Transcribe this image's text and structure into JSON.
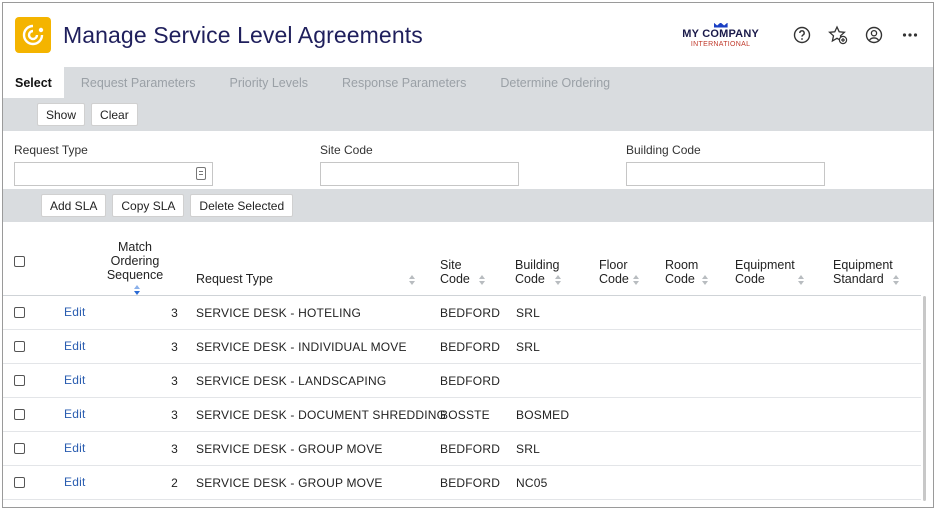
{
  "header": {
    "title": "Manage Service Level Agreements",
    "company_name": "MY COMPANY",
    "company_sub": "INTERNATIONAL"
  },
  "icons": [
    "app-logo-icon",
    "help-icon",
    "favorite-add-icon",
    "user-icon",
    "more-icon"
  ],
  "tabs": [
    {
      "label": "Select",
      "active": true
    },
    {
      "label": "Request Parameters",
      "active": false
    },
    {
      "label": "Priority Levels",
      "active": false
    },
    {
      "label": "Response Parameters",
      "active": false
    },
    {
      "label": "Determine Ordering",
      "active": false
    }
  ],
  "toolbar": {
    "show_label": "Show",
    "clear_label": "Clear"
  },
  "filters": {
    "request_type_label": "Request Type",
    "site_code_label": "Site Code",
    "building_code_label": "Building Code",
    "request_type_value": "",
    "site_code_value": "",
    "building_code_value": ""
  },
  "actions": {
    "add_label": "Add SLA",
    "copy_label": "Copy SLA",
    "delete_label": "Delete Selected"
  },
  "table": {
    "columns": {
      "match_1": "Match",
      "match_2": "Ordering",
      "match_3": "Sequence",
      "request_type": "Request Type",
      "site_1": "Site",
      "site_2": "Code",
      "building_1": "Building",
      "building_2": "Code",
      "floor_1": "Floor",
      "floor_2": "Code",
      "room_1": "Room",
      "room_2": "Code",
      "equipment_1": "Equipment",
      "equipment_2": "Code",
      "standard_1": "Equipment",
      "standard_2": "Standard"
    },
    "edit_label": "Edit",
    "rows": [
      {
        "seq": "3",
        "request_type": "SERVICE DESK - HOTELING",
        "site": "BEDFORD",
        "building": "SRL"
      },
      {
        "seq": "3",
        "request_type": "SERVICE DESK - INDIVIDUAL MOVE",
        "site": "BEDFORD",
        "building": "SRL"
      },
      {
        "seq": "3",
        "request_type": "SERVICE DESK - LANDSCAPING",
        "site": "BEDFORD",
        "building": ""
      },
      {
        "seq": "3",
        "request_type": "SERVICE DESK - DOCUMENT SHREDDING",
        "site": "BOSSTE",
        "building": "BOSMED"
      },
      {
        "seq": "3",
        "request_type": "SERVICE DESK - GROUP MOVE",
        "site": "BEDFORD",
        "building": "SRL"
      },
      {
        "seq": "2",
        "request_type": "SERVICE DESK - GROUP MOVE",
        "site": "BEDFORD",
        "building": "NC05"
      }
    ]
  },
  "colors": {
    "accent": "#f4b400",
    "title": "#1f1f5c",
    "link": "#2a5db0",
    "toolbar_bg": "#d9dcdf"
  }
}
